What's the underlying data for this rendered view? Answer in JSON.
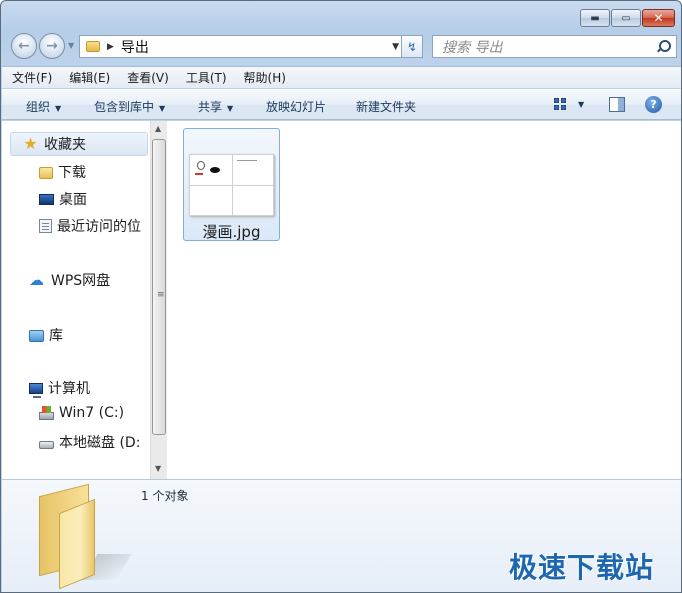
{
  "window": {
    "caption": {
      "minimize": "▬",
      "maximize": "▭",
      "close": "✕"
    }
  },
  "navigation": {
    "back_glyph": "←",
    "forward_glyph": "→",
    "breadcrumb": [
      "导出"
    ],
    "search_placeholder": "搜索 导出",
    "refresh_glyph": "↯"
  },
  "menubar": [
    "文件(F)",
    "编辑(E)",
    "查看(V)",
    "工具(T)",
    "帮助(H)"
  ],
  "toolbar": {
    "organize": "组织",
    "include_in_library": "包含到库中",
    "share": "共享",
    "slideshow": "放映幻灯片",
    "new_folder": "新建文件夹",
    "help": "?"
  },
  "navpane": {
    "favorites": "收藏夹",
    "downloads": "下载",
    "desktop": "桌面",
    "recent": "最近访问的位",
    "wps": "WPS网盘",
    "libraries": "库",
    "computer": "计算机",
    "drive_c": "Win7 (C:)",
    "drive_d": "本地磁盘 (D:"
  },
  "files": [
    {
      "name": "漫画.jpg",
      "icon": "image-thumbnail"
    }
  ],
  "details": {
    "count_text": "1 个对象"
  },
  "watermark": "极速下载站",
  "colors": {
    "accent": "#1d66b0",
    "selection_border": "#84acdd",
    "close_button": "#c2351f"
  }
}
